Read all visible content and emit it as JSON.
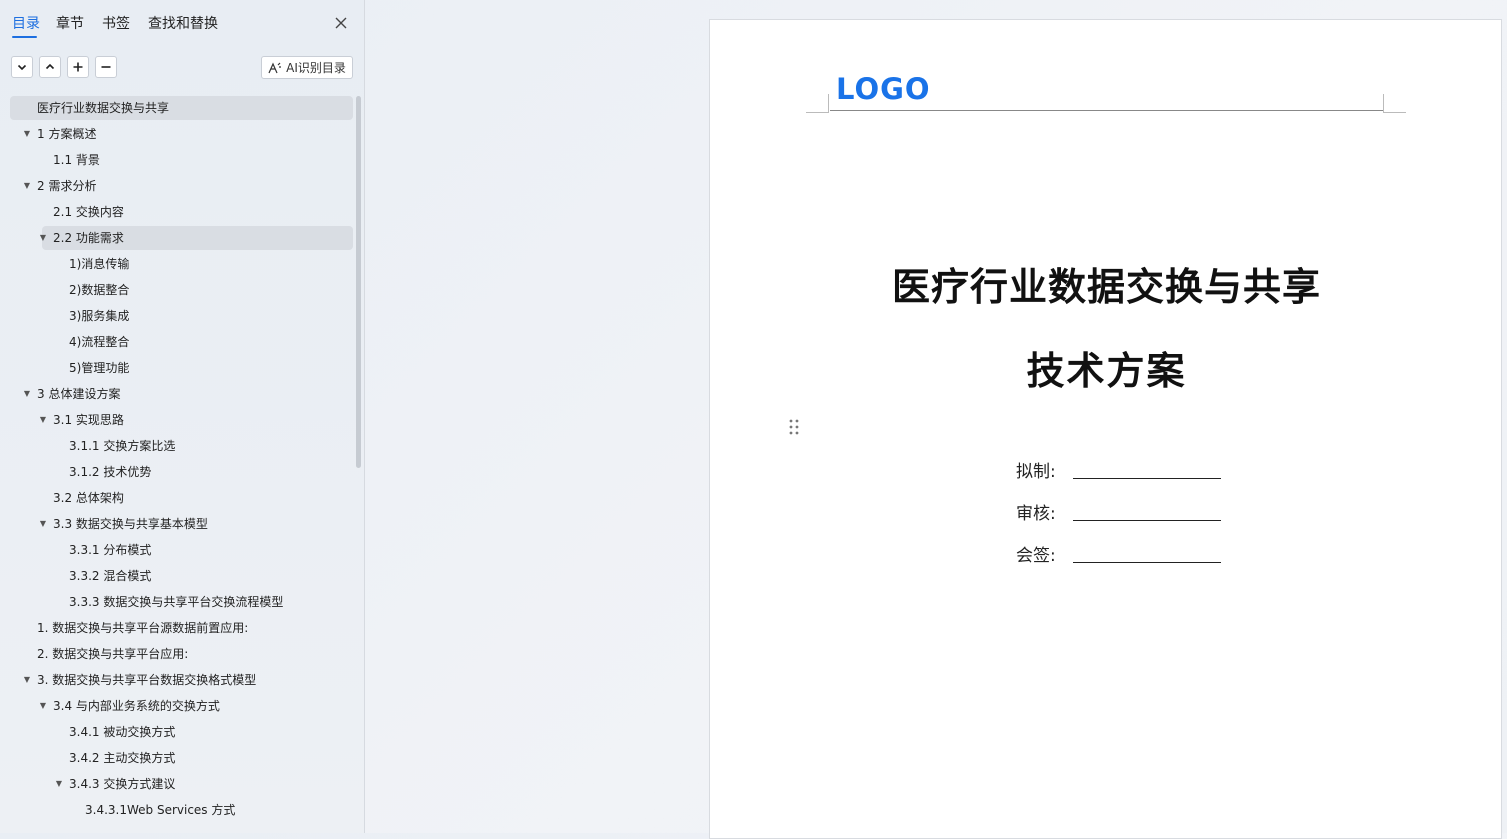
{
  "sidebar": {
    "tabs": [
      {
        "label": "目录",
        "active": true
      },
      {
        "label": "章节",
        "active": false
      },
      {
        "label": "书签",
        "active": false
      },
      {
        "label": "查找和替换",
        "active": false
      }
    ],
    "ai_button_label": "AI识别目录",
    "toc": [
      {
        "label": "医疗行业数据交换与共享",
        "level": 0,
        "expanded": null,
        "selected": true
      },
      {
        "label": "1 方案概述",
        "level": 0,
        "expanded": true
      },
      {
        "label": "1.1 背景",
        "level": 1,
        "expanded": null
      },
      {
        "label": "2 需求分析",
        "level": 0,
        "expanded": true
      },
      {
        "label": "2.1 交换内容",
        "level": 1,
        "expanded": null
      },
      {
        "label": "2.2 功能需求",
        "level": 1,
        "expanded": true,
        "highlight": true
      },
      {
        "label": "1)消息传输",
        "level": 2,
        "expanded": null
      },
      {
        "label": "2)数据整合",
        "level": 2,
        "expanded": null
      },
      {
        "label": "3)服务集成",
        "level": 2,
        "expanded": null
      },
      {
        "label": "4)流程整合",
        "level": 2,
        "expanded": null
      },
      {
        "label": "5)管理功能",
        "level": 2,
        "expanded": null
      },
      {
        "label": "3 总体建设方案",
        "level": 0,
        "expanded": true
      },
      {
        "label": "3.1 实现思路",
        "level": 1,
        "expanded": true
      },
      {
        "label": "3.1.1 交换方案比选",
        "level": 2,
        "expanded": null
      },
      {
        "label": "3.1.2 技术优势",
        "level": 2,
        "expanded": null
      },
      {
        "label": "3.2 总体架构",
        "level": 1,
        "expanded": null
      },
      {
        "label": "3.3 数据交换与共享基本模型",
        "level": 1,
        "expanded": true
      },
      {
        "label": "3.3.1 分布模式",
        "level": 2,
        "expanded": null
      },
      {
        "label": "3.3.2 混合模式",
        "level": 2,
        "expanded": null
      },
      {
        "label": "3.3.3 数据交换与共享平台交换流程模型",
        "level": 2,
        "expanded": null
      },
      {
        "label": "1. 数据交换与共享平台源数据前置应用:",
        "level": 0,
        "expanded": null
      },
      {
        "label": "2. 数据交换与共享平台应用:",
        "level": 0,
        "expanded": null
      },
      {
        "label": "3. 数据交换与共享平台数据交换格式模型",
        "level": 0,
        "expanded": true
      },
      {
        "label": "3.4 与内部业务系统的交换方式",
        "level": 1,
        "expanded": true
      },
      {
        "label": "3.4.1 被动交换方式",
        "level": 2,
        "expanded": null
      },
      {
        "label": "3.4.2 主动交换方式",
        "level": 2,
        "expanded": null
      },
      {
        "label": "3.4.3 交换方式建议",
        "level": 2,
        "expanded": true
      },
      {
        "label": "3.4.3.1Web Services 方式",
        "level": 3,
        "expanded": null
      }
    ]
  },
  "document": {
    "logo_text": "LOGO",
    "title_line1": "医疗行业数据交换与共享",
    "title_line2": "技术方案",
    "signature_fields": [
      {
        "label": "拟制:"
      },
      {
        "label": "审核:"
      },
      {
        "label": "会签:"
      }
    ]
  },
  "colors": {
    "accent": "#1d6fe0",
    "logo": "#1a73e8",
    "sidebar_selected": "#d9dde3"
  }
}
